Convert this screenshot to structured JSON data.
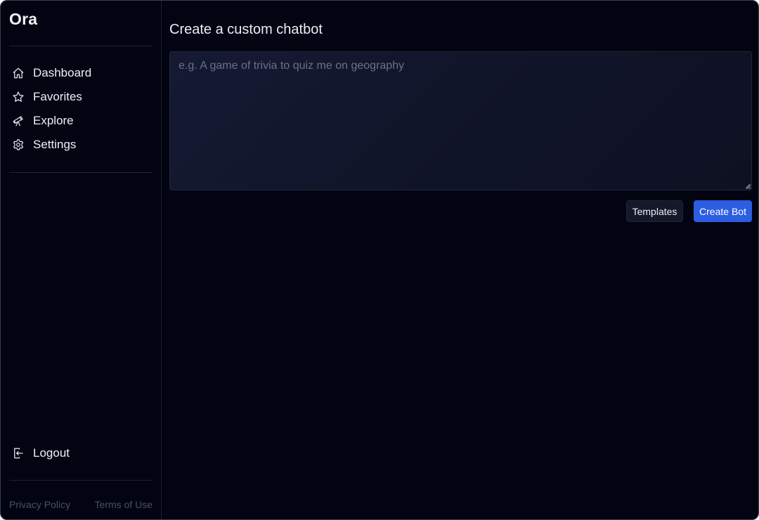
{
  "app": {
    "name": "Ora"
  },
  "sidebar": {
    "items": [
      {
        "label": "Dashboard",
        "icon": "home-icon"
      },
      {
        "label": "Favorites",
        "icon": "star-icon"
      },
      {
        "label": "Explore",
        "icon": "telescope-icon"
      },
      {
        "label": "Settings",
        "icon": "gear-icon"
      }
    ],
    "logout": {
      "label": "Logout",
      "icon": "logout-icon"
    },
    "footer": {
      "privacy": "Privacy Policy",
      "terms": "Terms of Use"
    }
  },
  "main": {
    "title": "Create a custom chatbot",
    "prompt": {
      "value": "",
      "placeholder": "e.g. A game of trivia to quiz me on geography"
    },
    "buttons": {
      "templates": "Templates",
      "create": "Create Bot"
    }
  },
  "colors": {
    "background": "#020412",
    "accent": "#2b5ee0",
    "text": "#eceef4",
    "muted": "#4b5066"
  }
}
